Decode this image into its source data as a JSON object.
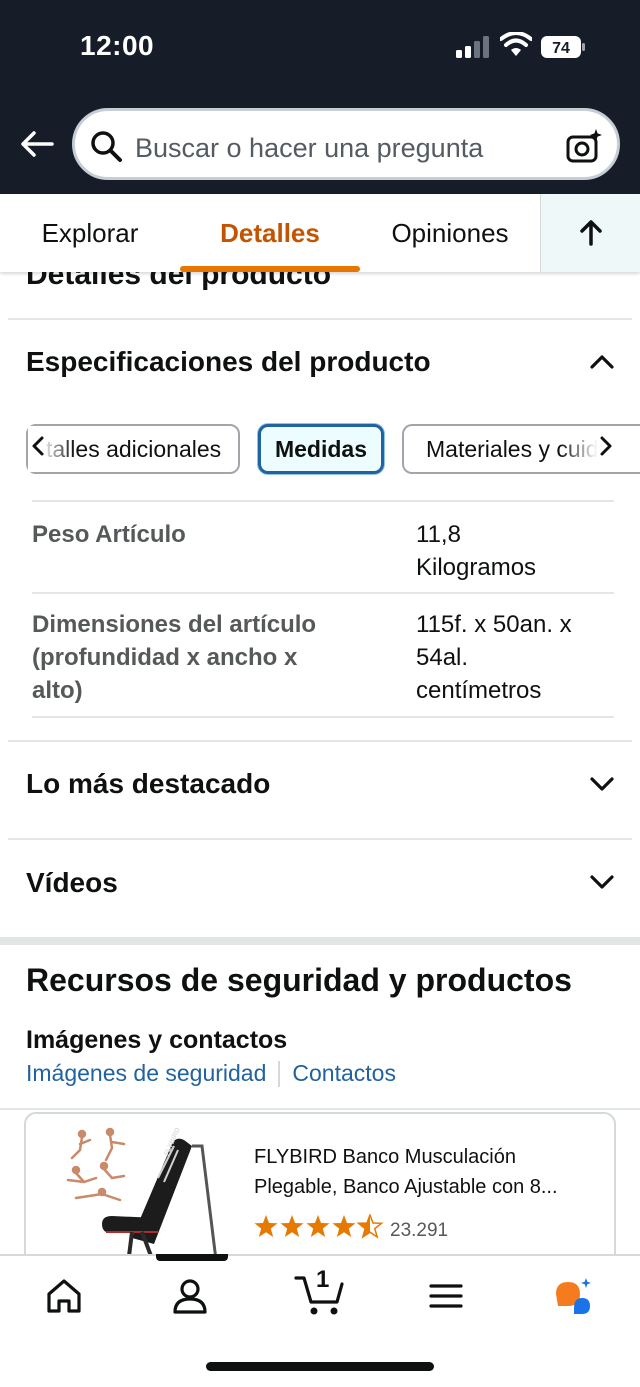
{
  "status_bar": {
    "time": "12:00",
    "battery": "74"
  },
  "search": {
    "placeholder": "Buscar o hacer una pregunta"
  },
  "tabs": [
    {
      "label": "Explorar",
      "active": false
    },
    {
      "label": "Detalles",
      "active": true
    },
    {
      "label": "Opiniones",
      "active": false
    }
  ],
  "cut_title": "Detalles del producto",
  "specs_section": {
    "title": "Especificaciones del producto",
    "pills": [
      "Detalles adicionales",
      "Medidas",
      "Materiales y cuidado"
    ],
    "pill_left_visible": "talles adicionales",
    "pill_right_visible": "Materiales y cuid",
    "rows": [
      {
        "key": "Peso Artículo",
        "value_lines": [
          "11,8",
          "Kilogramos"
        ]
      },
      {
        "key_lines": [
          "Dimensiones del artículo",
          "(profundidad x ancho x",
          "alto)"
        ],
        "value_lines": [
          "115f. x 50an. x",
          "54al.",
          "centímetros"
        ]
      }
    ]
  },
  "highlights_section": {
    "title": "Lo más destacado"
  },
  "videos_section": {
    "title": "Vídeos"
  },
  "resources": {
    "title": "Recursos de seguridad y productos",
    "subtitle": "Imágenes y contactos",
    "link_images": "Imágenes de seguridad",
    "link_contacts": "Contactos"
  },
  "product": {
    "name_line1": "FLYBIRD Banco Musculación",
    "name_line2": "Plegable, Banco Ajustable con 8...",
    "rating": 4.5,
    "rating_count": "23.291",
    "brand_mark": "FLYBIRD"
  },
  "cart": {
    "count": "1"
  },
  "colors": {
    "header_bg": "#161d29",
    "tab_active": "#c45500",
    "tab_underline": "#e77600",
    "link": "#2162a1",
    "star": "#e67a00",
    "pill_selected_border": "#2162a1"
  }
}
